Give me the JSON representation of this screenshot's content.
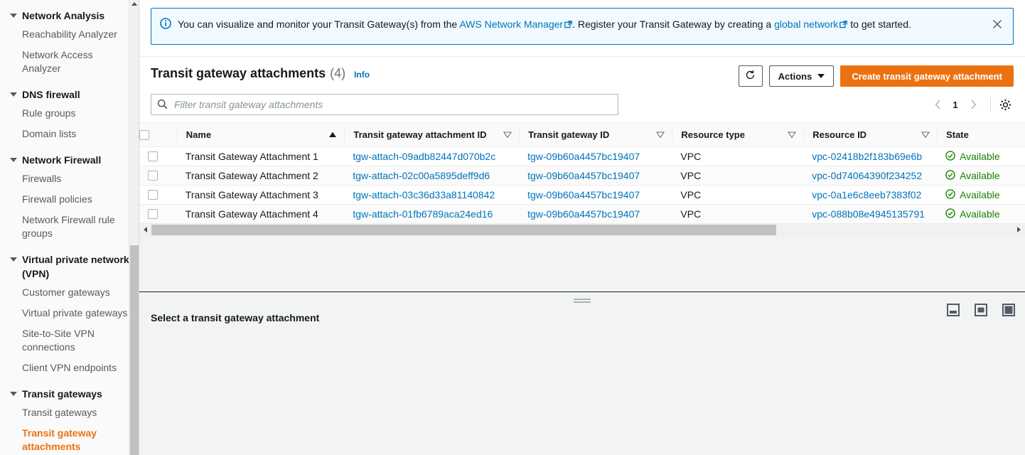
{
  "sidebar": {
    "groups": [
      {
        "label": "Network Analysis",
        "icon": "caret-down-icon",
        "items": [
          {
            "label": "Reachability Analyzer",
            "active": false
          },
          {
            "label": "Network Access Analyzer",
            "active": false
          }
        ]
      },
      {
        "label": "DNS firewall",
        "icon": "caret-down-icon",
        "items": [
          {
            "label": "Rule groups",
            "active": false
          },
          {
            "label": "Domain lists",
            "active": false
          }
        ]
      },
      {
        "label": "Network Firewall",
        "icon": "caret-down-icon",
        "items": [
          {
            "label": "Firewalls",
            "active": false
          },
          {
            "label": "Firewall policies",
            "active": false
          },
          {
            "label": "Network Firewall rule groups",
            "active": false
          }
        ]
      },
      {
        "label": "Virtual private network (VPN)",
        "icon": "caret-down-icon",
        "items": [
          {
            "label": "Customer gateways",
            "active": false
          },
          {
            "label": "Virtual private gateways",
            "active": false
          },
          {
            "label": "Site-to-Site VPN connections",
            "active": false
          },
          {
            "label": "Client VPN endpoints",
            "active": false
          }
        ]
      },
      {
        "label": "Transit gateways",
        "icon": "caret-down-icon",
        "items": [
          {
            "label": "Transit gateways",
            "active": false
          },
          {
            "label": "Transit gateway attachments",
            "active": true
          }
        ]
      }
    ]
  },
  "banner": {
    "icon": "info-circle-icon",
    "text_part1": "You can visualize and monitor your Transit Gateway(s) from the ",
    "link1": "AWS Network Manager",
    "text_part2": ". Register your Transit Gateway by creating a ",
    "link2": "global network",
    "text_part3": " to get started.",
    "close_icon": "close-icon",
    "border_color": "#0073bb",
    "background_color": "#f1faff"
  },
  "panel": {
    "title": "Transit gateway attachments",
    "count": "(4)",
    "info_label": "Info",
    "refresh_icon": "refresh-icon",
    "actions_label": "Actions",
    "create_label": "Create transit gateway attachment",
    "primary_color": "#ec7211"
  },
  "search": {
    "icon": "search-icon",
    "placeholder": "Filter transit gateway attachments",
    "value": ""
  },
  "pagination": {
    "prev_icon": "chevron-left-icon",
    "page": "1",
    "next_icon": "chevron-right-icon",
    "settings_icon": "gear-icon"
  },
  "table": {
    "columns": [
      {
        "label": "Name",
        "sort": "asc"
      },
      {
        "label": "Transit gateway attachment ID",
        "sort": "none"
      },
      {
        "label": "Transit gateway ID",
        "sort": "none"
      },
      {
        "label": "Resource type",
        "sort": "none"
      },
      {
        "label": "Resource ID",
        "sort": "none"
      },
      {
        "label": "State",
        "sort": null
      }
    ],
    "rows": [
      {
        "name": "Transit Gateway Attachment 1",
        "attachment_id": "tgw-attach-09adb82447d070b2c",
        "tgw_id": "tgw-09b60a4457bc19407",
        "resource_type": "VPC",
        "resource_id": "vpc-02418b2f183b69e6b",
        "state": "Available",
        "state_icon": "check-circle-icon"
      },
      {
        "name": "Transit Gateway Attachment 2",
        "attachment_id": "tgw-attach-02c00a5895deff9d6",
        "tgw_id": "tgw-09b60a4457bc19407",
        "resource_type": "VPC",
        "resource_id": "vpc-0d74064390f234252",
        "state": "Available",
        "state_icon": "check-circle-icon"
      },
      {
        "name": "Transit Gateway Attachment 3",
        "attachment_id": "tgw-attach-03c36d33a81140842",
        "tgw_id": "tgw-09b60a4457bc19407",
        "resource_type": "VPC",
        "resource_id": "vpc-0a1e6c8eeb7383f02",
        "state": "Available",
        "state_icon": "check-circle-icon"
      },
      {
        "name": "Transit Gateway Attachment 4",
        "attachment_id": "tgw-attach-01fb6789aca24ed16",
        "tgw_id": "tgw-09b60a4457bc19407",
        "resource_type": "VPC",
        "resource_id": "vpc-088b08e4945135791",
        "state": "Available",
        "state_icon": "check-circle-icon"
      }
    ],
    "state_color": "#1d8102",
    "link_color": "#0073bb"
  },
  "split_panel": {
    "title": "Select a transit gateway attachment",
    "layout_buttons": [
      "panel-bottom-icon",
      "panel-side-icon",
      "panel-full-icon"
    ]
  }
}
